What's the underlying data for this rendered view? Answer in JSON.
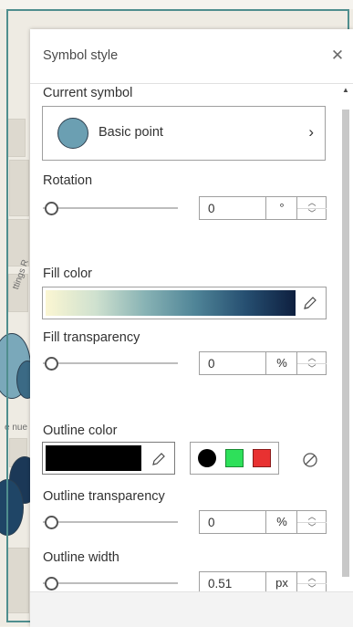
{
  "panel": {
    "title": "Symbol style",
    "close_icon": "close-icon"
  },
  "current_symbol": {
    "label": "Current symbol",
    "name": "Basic point",
    "swatch_color": "#6b9fb2",
    "chevron_icon": "chevron-right-icon"
  },
  "rotation": {
    "label": "Rotation",
    "value": "0",
    "unit": "°",
    "slider_value": 0
  },
  "fill_color": {
    "label": "Fill color",
    "ramp_colors": [
      "#fbf6d2",
      "#cfe1cf",
      "#87b2b4",
      "#4f8497",
      "#264f71",
      "#0e1f3f"
    ],
    "edit_icon": "pencil-icon"
  },
  "fill_transparency": {
    "label": "Fill transparency",
    "value": "0",
    "unit": "%",
    "slider_value": 0
  },
  "outline_color": {
    "label": "Outline color",
    "color": "#000000",
    "edit_icon": "pencil-icon",
    "quick_colors": [
      "#000000",
      "#2ee05a",
      "#e83131"
    ],
    "no_color_icon": "no-color-icon"
  },
  "outline_transparency": {
    "label": "Outline transparency",
    "value": "0",
    "unit": "%",
    "slider_value": 0
  },
  "outline_width": {
    "label": "Outline width",
    "value": "0.51",
    "unit": "px",
    "slider_value": 0.51
  },
  "map": {
    "labels": [
      "ttings R",
      "e nue"
    ]
  }
}
